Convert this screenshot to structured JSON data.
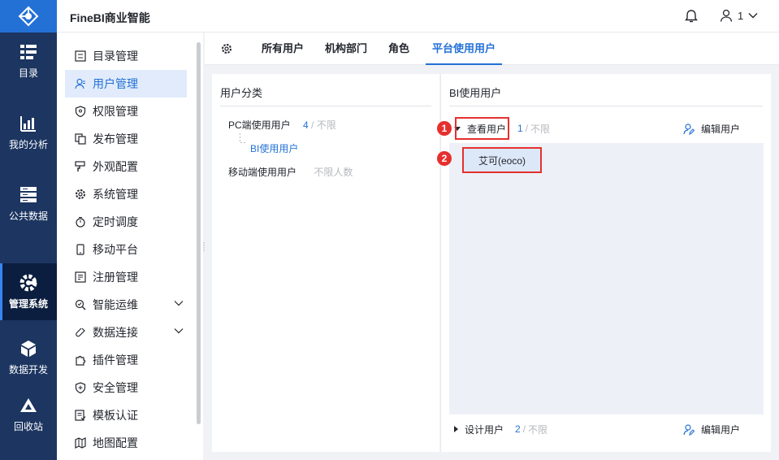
{
  "app": {
    "title": "FineBI商业智能",
    "user_name": "1"
  },
  "leftnav": [
    {
      "label": "目录",
      "icon": "catalog-icon"
    },
    {
      "label": "我的分析",
      "icon": "analysis-icon"
    },
    {
      "label": "公共数据",
      "icon": "public-data-icon"
    },
    {
      "label": "管理系统",
      "icon": "management-icon",
      "active": true
    },
    {
      "label": "数据开发",
      "icon": "data-dev-icon"
    },
    {
      "label": "回收站",
      "icon": "recycle-icon"
    }
  ],
  "submenu": [
    {
      "label": "目录管理"
    },
    {
      "label": "用户管理",
      "active": true
    },
    {
      "label": "权限管理"
    },
    {
      "label": "发布管理"
    },
    {
      "label": "外观配置"
    },
    {
      "label": "系统管理"
    },
    {
      "label": "定时调度"
    },
    {
      "label": "移动平台"
    },
    {
      "label": "注册管理"
    },
    {
      "label": "智能运维",
      "expandable": true
    },
    {
      "label": "数据连接",
      "expandable": true
    },
    {
      "label": "插件管理"
    },
    {
      "label": "安全管理"
    },
    {
      "label": "模板认证"
    },
    {
      "label": "地图配置"
    }
  ],
  "tabs": [
    {
      "label": "所有用户"
    },
    {
      "label": "机构部门"
    },
    {
      "label": "角色"
    },
    {
      "label": "平台使用用户",
      "active": true
    }
  ],
  "left_panel": {
    "title": "用户分类",
    "rows": [
      {
        "label": "PC端使用用户",
        "count": "4",
        "sep": "/",
        "limit": "不限"
      },
      {
        "label": "BI使用用户"
      },
      {
        "label": "移动端使用用户",
        "limit": "不限人数"
      }
    ]
  },
  "right_panel": {
    "title": "BI使用用户",
    "view_section": {
      "label": "查看用户",
      "count": "1",
      "sep": "/",
      "limit": "不限",
      "edit_label": "编辑用户",
      "users": [
        "艾可(eoco)"
      ]
    },
    "design_section": {
      "label": "设计用户",
      "count": "2",
      "sep": "/",
      "limit": "不限",
      "edit_label": "编辑用户"
    }
  },
  "annotations": [
    "1",
    "2"
  ],
  "colors": {
    "brand": "#2471d6",
    "nav_bg": "#1c3561",
    "highlight": "#e5302f"
  }
}
